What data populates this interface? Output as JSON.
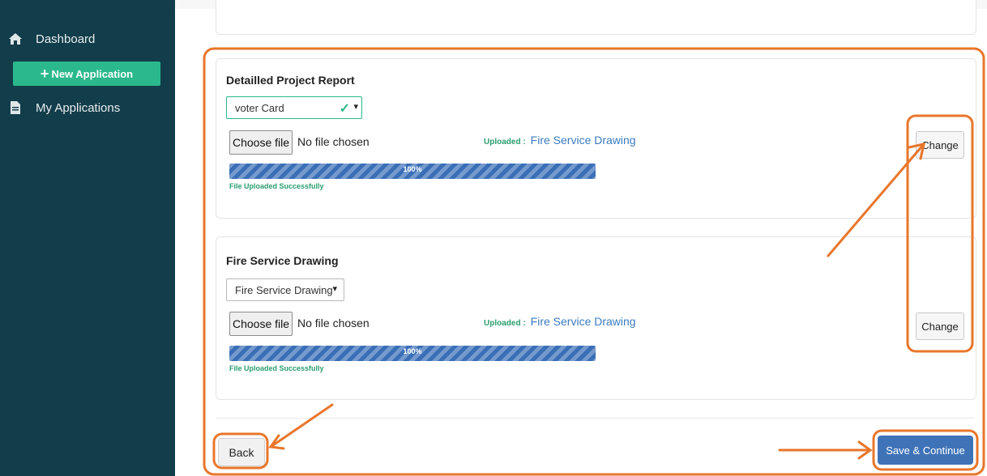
{
  "sidebar": {
    "dashboard_label": "Dashboard",
    "new_application_label": "New Application",
    "my_applications_label": "My Applications",
    "icons": {
      "dashboard": "home-icon",
      "new": "plus-icon",
      "applications": "file-icon"
    }
  },
  "sections": [
    {
      "title": "Detailled Project Report",
      "select_value": "voter Card",
      "choose_file_label": "Choose file",
      "no_file_text": "No file chosen",
      "uploaded_label": "Uploaded :",
      "uploaded_value": "Fire Service Drawing",
      "progress_text": "100%",
      "progress": 1.0,
      "status_text": "File Uploaded Successfully",
      "change_label": "Change"
    },
    {
      "title": "Fire Service Drawing",
      "select_value": "Fire Service Drawing",
      "choose_file_label": "Choose file",
      "no_file_text": "No file chosen",
      "uploaded_label": "Uploaded :",
      "uploaded_value": "Fire Service Drawing",
      "progress_text": "100%",
      "progress": 1.0,
      "status_text": "File Uploaded Successfully",
      "change_label": "Change"
    }
  ],
  "footer": {
    "back_label": "Back",
    "save_label": "Save & Continue"
  },
  "colors": {
    "sidebar_bg": "#123d4a",
    "new_button": "#2bb88c",
    "annotation": "#e8762b",
    "primary": "#3f73b8"
  }
}
